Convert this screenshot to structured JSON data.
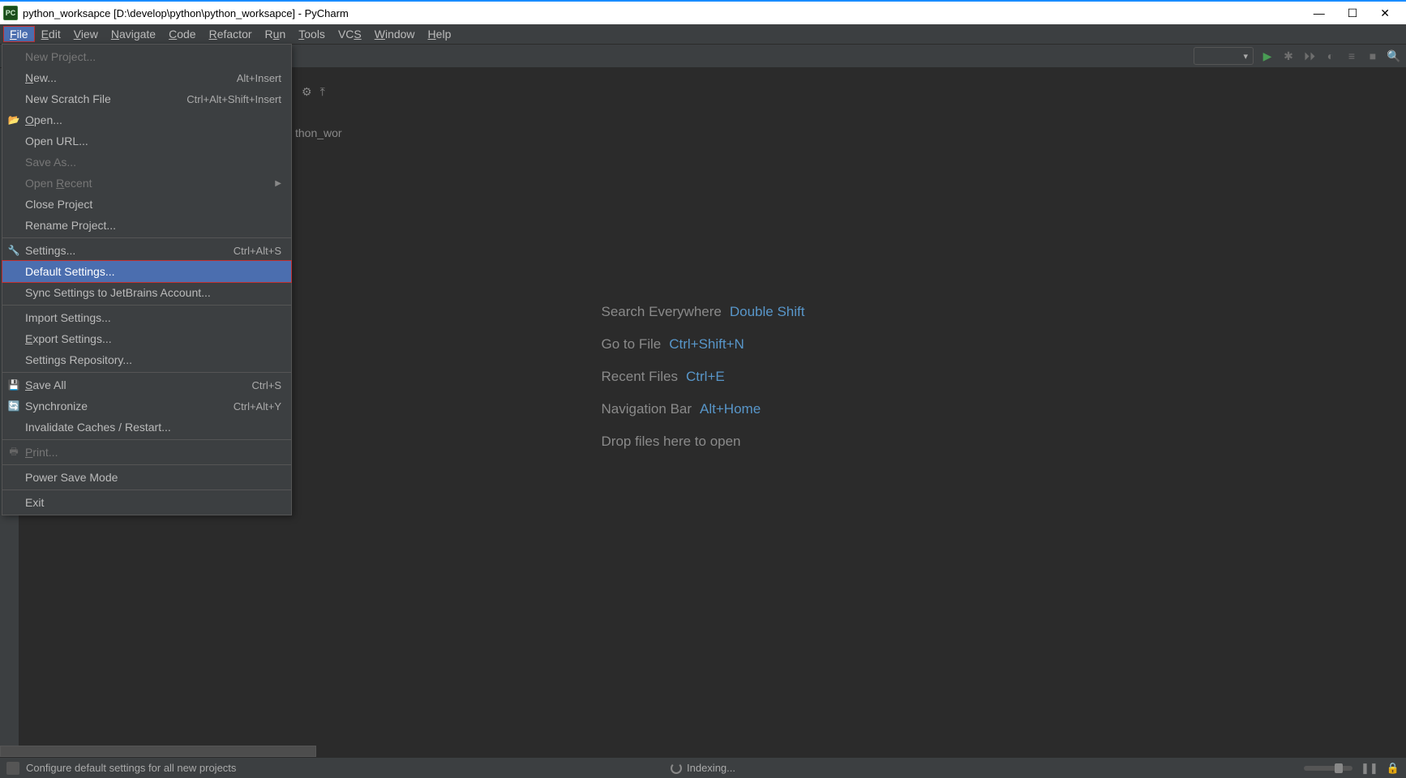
{
  "window": {
    "title": "python_worksapce [D:\\develop\\python\\python_worksapce] - PyCharm",
    "app_icon_label": "PC",
    "min": "—",
    "max": "☐",
    "close": "✕"
  },
  "menubar": {
    "items": [
      {
        "label": "File",
        "mn": "F",
        "selected": true
      },
      {
        "label": "Edit",
        "mn": "E"
      },
      {
        "label": "View",
        "mn": "V"
      },
      {
        "label": "Navigate",
        "mn": "N"
      },
      {
        "label": "Code",
        "mn": "C"
      },
      {
        "label": "Refactor",
        "mn": "R"
      },
      {
        "label": "Run",
        "mn": "u"
      },
      {
        "label": "Tools",
        "mn": "T"
      },
      {
        "label": "VCS",
        "mn": "S"
      },
      {
        "label": "Window",
        "mn": "W"
      },
      {
        "label": "Help",
        "mn": "H"
      }
    ]
  },
  "toolbar": {
    "combo_arrow": "▾",
    "icons": [
      "play",
      "debug",
      "coverage",
      "profile",
      "list",
      "stop",
      "search"
    ]
  },
  "file_menu": {
    "items": [
      {
        "label": "New Project...",
        "disabled": true
      },
      {
        "label": "New...",
        "mn": "N",
        "shortcut": "Alt+Insert"
      },
      {
        "label": "New Scratch File",
        "shortcut": "Ctrl+Alt+Shift+Insert"
      },
      {
        "label": "Open...",
        "mn": "O",
        "icon": "folder"
      },
      {
        "label": "Open URL..."
      },
      {
        "label": "Save As...",
        "disabled": true
      },
      {
        "label": "Open Recent",
        "mn": "R",
        "submenu": true,
        "disabled": true
      },
      {
        "label": "Close Project"
      },
      {
        "label": "Rename Project..."
      },
      {
        "sep": true
      },
      {
        "label": "Settings...",
        "shortcut": "Ctrl+Alt+S",
        "icon": "wrench"
      },
      {
        "label": "Default Settings...",
        "selected": true,
        "highlight": true
      },
      {
        "label": "Sync Settings to JetBrains Account..."
      },
      {
        "sep": true
      },
      {
        "label": "Import Settings..."
      },
      {
        "label": "Export Settings...",
        "mn": "E"
      },
      {
        "label": "Settings Repository..."
      },
      {
        "sep": true
      },
      {
        "label": "Save All",
        "mn": "S",
        "shortcut": "Ctrl+S",
        "icon": "save"
      },
      {
        "label": "Synchronize",
        "shortcut": "Ctrl+Alt+Y",
        "icon": "sync"
      },
      {
        "label": "Invalidate Caches / Restart..."
      },
      {
        "sep": true
      },
      {
        "label": "Print...",
        "mn": "P",
        "disabled": true,
        "icon": "print"
      },
      {
        "sep": true
      },
      {
        "label": "Power Save Mode"
      },
      {
        "sep": true
      },
      {
        "label": "Exit"
      }
    ]
  },
  "project_fragment": "thon_wor",
  "editor_hints": {
    "rows": [
      {
        "label": "Search Everywhere",
        "kbd": "Double Shift"
      },
      {
        "label": "Go to File",
        "kbd": "Ctrl+Shift+N"
      },
      {
        "label": "Recent Files",
        "kbd": "Ctrl+E"
      },
      {
        "label": "Navigation Bar",
        "kbd": "Alt+Home"
      },
      {
        "label": "Drop files here to open",
        "kbd": ""
      }
    ]
  },
  "statusbar": {
    "left": "Configure default settings for all new projects",
    "center": "Indexing...",
    "pause": "❚❚",
    "lock": "🔒"
  }
}
